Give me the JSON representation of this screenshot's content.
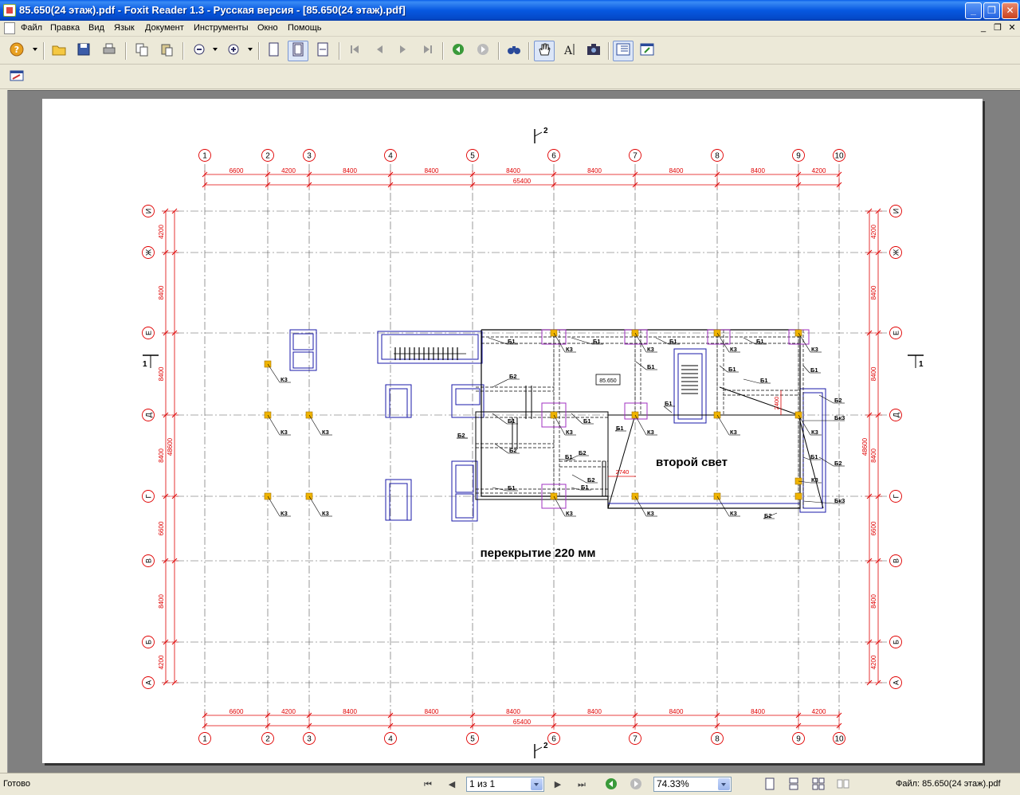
{
  "window": {
    "title": "85.650(24 этаж).pdf - Foxit Reader 1.3 - Русская версия  - [85.650(24 этаж).pdf]",
    "min_label": "_",
    "max_label": "❐",
    "close_label": "✕"
  },
  "menu": {
    "items": [
      "Файл",
      "Правка",
      "Вид",
      "Язык",
      "Документ",
      "Инструменты",
      "Окно",
      "Помощь"
    ],
    "mdi_min": "_",
    "mdi_restore": "❐",
    "mdi_close": "✕"
  },
  "drawing": {
    "grid_cols": [
      "1",
      "2",
      "3",
      "4",
      "5",
      "6",
      "7",
      "8",
      "9",
      "10"
    ],
    "col_dims": [
      "6600",
      "4200",
      "8400",
      "8400",
      "8400",
      "8400",
      "8400",
      "8400",
      "4200"
    ],
    "total_width": "65400",
    "grid_rows": [
      "И",
      "Ж",
      "Е",
      "Д",
      "Г",
      "В",
      "Б",
      "А"
    ],
    "row_dims": [
      "4200",
      "8400",
      "8400",
      "8400",
      "6600",
      "8400",
      "4200"
    ],
    "total_height": "48600",
    "section_mark_2": "2",
    "section_mark_1": "1",
    "column_label": "К3",
    "beam_b1": "Б1",
    "beam_b2": "Б2",
    "beam_bk3": "Бк3",
    "level_tag": "85.650",
    "dim_2740": "2740",
    "dim_2400": "2400",
    "text_second_light": "второй свет",
    "text_slab": "перекрытие 220 мм"
  },
  "status": {
    "ready": "Готово",
    "page_value": "1 из 1",
    "zoom_value": "74.33%",
    "file_info": "Файл: 85.650(24 этаж).pdf"
  },
  "colors": {
    "grid_red": "#e00000",
    "wall_blue": "#1a1aa8",
    "column_yellow": "#f0b400",
    "opening_purple": "#a030c0"
  }
}
